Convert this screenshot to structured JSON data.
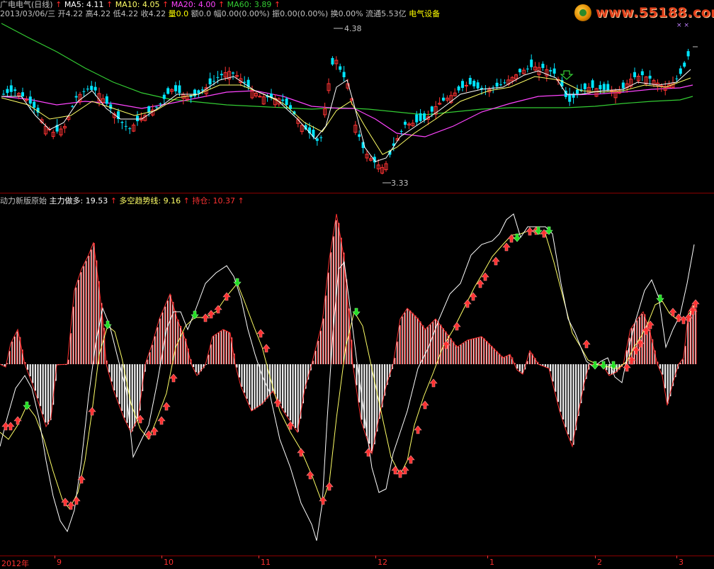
{
  "header": {
    "stock_name": "广电电气(日线)",
    "ma5_label": "MA5: 4.11",
    "ma10_label": "MA10: 4.05",
    "ma20_label": "MA20: 4.00",
    "ma60_label": "MA60: 3.89",
    "arrow_glyph": "↑",
    "date": "2013/03/06/三",
    "open": "开4.22",
    "high": "高4.22",
    "low": "低4.22",
    "close": "收4.22",
    "volume": "量0.0",
    "amount": "额0.0",
    "change": "幅0.00(0.00%)",
    "amplitude": "振0.00(0.00%)",
    "turnover": "换0.00%",
    "float": "流通5.53亿",
    "sector": "电气设备"
  },
  "price_panel": {
    "high_label": "4.38",
    "low_label": "3.33"
  },
  "indicator": {
    "name": "动力新版原始",
    "main_long": "主力做多: 19.53",
    "trend_line": "多空趋势线: 9.16",
    "position": "持仓: 10.37"
  },
  "date_axis": {
    "labels": [
      "2012年",
      "9",
      "10",
      "11",
      "12",
      "1",
      "2",
      "3"
    ]
  },
  "watermark": {
    "text": "www.55188.com",
    "marks": "× ×"
  },
  "colors": {
    "ma5": "#ffffff",
    "ma10": "#ffff66",
    "ma20": "#ff44ff",
    "ma60": "#33cc33",
    "up": "#ff3333",
    "down": "#00e5ff",
    "label_grey": "#c0c0c0",
    "label_yellow": "#ffff00",
    "label_red": "#ff3333"
  }
}
